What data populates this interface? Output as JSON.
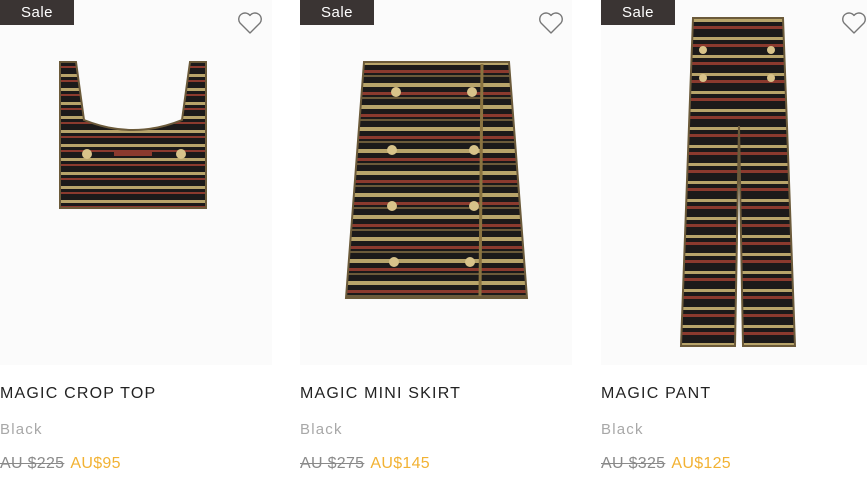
{
  "products": [
    {
      "badge": "Sale",
      "name": "MAGIC CROP TOP",
      "color": "Black",
      "price_was": "AU $225",
      "price_now": "AU$95",
      "wishlist_icon": "heart-outline-icon"
    },
    {
      "badge": "Sale",
      "name": "MAGIC MINI SKIRT",
      "color": "Black",
      "price_was": "AU $275",
      "price_now": "AU$145",
      "wishlist_icon": "heart-outline-icon"
    },
    {
      "badge": "Sale",
      "name": "MAGIC PANT",
      "color": "Black",
      "price_was": "AU $325",
      "price_now": "AU$125",
      "wishlist_icon": "heart-outline-icon"
    }
  ],
  "colors": {
    "badge_bg": "#3a3433",
    "sale_price": "#f2b233",
    "old_price": "#8a8a8a",
    "garment_base": "#1c1a1a",
    "stripe_gold": "#b8a46a",
    "stripe_red": "#8b3a2e"
  }
}
